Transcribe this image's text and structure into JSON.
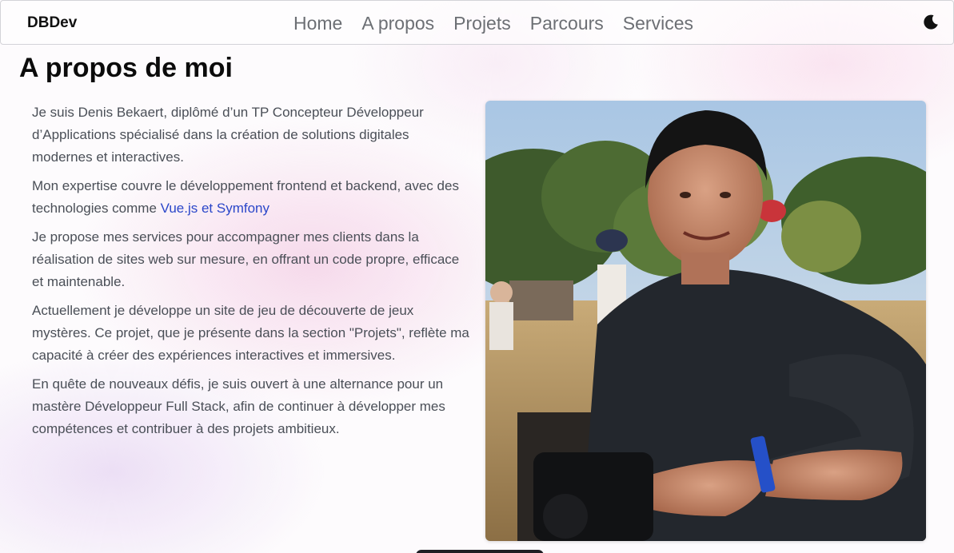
{
  "navbar": {
    "brand": "DBDev",
    "links": [
      "Home",
      "A propos",
      "Projets",
      "Parcours",
      "Services"
    ],
    "theme_toggle_icon": "moon-icon"
  },
  "about": {
    "title": "A propos de moi",
    "paragraphs": [
      "Je suis Denis Bekaert, diplômé d’un TP Concepteur Développeur d’Applications spécialisé dans la création de solutions digitales modernes et interactives.",
      "Je propose mes services pour accompagner mes clients dans la réalisation de sites web sur mesure, en offrant un code propre, efficace et maintenable.",
      "Actuellement je développe un site de jeu de découverte de jeux mystères. Ce projet, que je présente dans la section \"Projets\", reflète ma capacité à créer des expériences interactives et immersives.",
      "En quête de nouveaux défis, je suis ouvert à une alternance pour un mastère Développeur Full Stack, afin de continuer à développer mes compétences et contribuer à des projets ambitieux."
    ],
    "expertise_prefix": "Mon expertise couvre le développement frontend et backend, avec des technologies comme ",
    "expertise_link": "Vue.js et Symfony",
    "photo_icon": "portrait-photo"
  },
  "colors": {
    "link": "#2b47c9",
    "nav_text": "#6c6f74",
    "body_text": "#4a4f57"
  }
}
